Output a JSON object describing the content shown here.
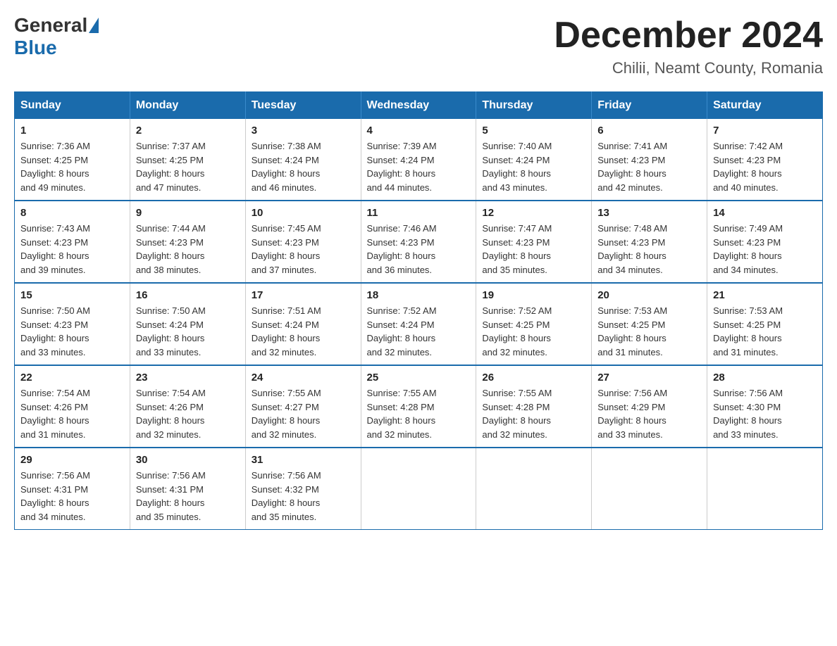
{
  "logo": {
    "general": "General",
    "blue": "Blue"
  },
  "title": "December 2024",
  "subtitle": "Chilii, Neamt County, Romania",
  "days_of_week": [
    "Sunday",
    "Monday",
    "Tuesday",
    "Wednesday",
    "Thursday",
    "Friday",
    "Saturday"
  ],
  "weeks": [
    [
      {
        "day": "1",
        "sunrise": "7:36 AM",
        "sunset": "4:25 PM",
        "daylight": "8 hours and 49 minutes."
      },
      {
        "day": "2",
        "sunrise": "7:37 AM",
        "sunset": "4:25 PM",
        "daylight": "8 hours and 47 minutes."
      },
      {
        "day": "3",
        "sunrise": "7:38 AM",
        "sunset": "4:24 PM",
        "daylight": "8 hours and 46 minutes."
      },
      {
        "day": "4",
        "sunrise": "7:39 AM",
        "sunset": "4:24 PM",
        "daylight": "8 hours and 44 minutes."
      },
      {
        "day": "5",
        "sunrise": "7:40 AM",
        "sunset": "4:24 PM",
        "daylight": "8 hours and 43 minutes."
      },
      {
        "day": "6",
        "sunrise": "7:41 AM",
        "sunset": "4:23 PM",
        "daylight": "8 hours and 42 minutes."
      },
      {
        "day": "7",
        "sunrise": "7:42 AM",
        "sunset": "4:23 PM",
        "daylight": "8 hours and 40 minutes."
      }
    ],
    [
      {
        "day": "8",
        "sunrise": "7:43 AM",
        "sunset": "4:23 PM",
        "daylight": "8 hours and 39 minutes."
      },
      {
        "day": "9",
        "sunrise": "7:44 AM",
        "sunset": "4:23 PM",
        "daylight": "8 hours and 38 minutes."
      },
      {
        "day": "10",
        "sunrise": "7:45 AM",
        "sunset": "4:23 PM",
        "daylight": "8 hours and 37 minutes."
      },
      {
        "day": "11",
        "sunrise": "7:46 AM",
        "sunset": "4:23 PM",
        "daylight": "8 hours and 36 minutes."
      },
      {
        "day": "12",
        "sunrise": "7:47 AM",
        "sunset": "4:23 PM",
        "daylight": "8 hours and 35 minutes."
      },
      {
        "day": "13",
        "sunrise": "7:48 AM",
        "sunset": "4:23 PM",
        "daylight": "8 hours and 34 minutes."
      },
      {
        "day": "14",
        "sunrise": "7:49 AM",
        "sunset": "4:23 PM",
        "daylight": "8 hours and 34 minutes."
      }
    ],
    [
      {
        "day": "15",
        "sunrise": "7:50 AM",
        "sunset": "4:23 PM",
        "daylight": "8 hours and 33 minutes."
      },
      {
        "day": "16",
        "sunrise": "7:50 AM",
        "sunset": "4:24 PM",
        "daylight": "8 hours and 33 minutes."
      },
      {
        "day": "17",
        "sunrise": "7:51 AM",
        "sunset": "4:24 PM",
        "daylight": "8 hours and 32 minutes."
      },
      {
        "day": "18",
        "sunrise": "7:52 AM",
        "sunset": "4:24 PM",
        "daylight": "8 hours and 32 minutes."
      },
      {
        "day": "19",
        "sunrise": "7:52 AM",
        "sunset": "4:25 PM",
        "daylight": "8 hours and 32 minutes."
      },
      {
        "day": "20",
        "sunrise": "7:53 AM",
        "sunset": "4:25 PM",
        "daylight": "8 hours and 31 minutes."
      },
      {
        "day": "21",
        "sunrise": "7:53 AM",
        "sunset": "4:25 PM",
        "daylight": "8 hours and 31 minutes."
      }
    ],
    [
      {
        "day": "22",
        "sunrise": "7:54 AM",
        "sunset": "4:26 PM",
        "daylight": "8 hours and 31 minutes."
      },
      {
        "day": "23",
        "sunrise": "7:54 AM",
        "sunset": "4:26 PM",
        "daylight": "8 hours and 32 minutes."
      },
      {
        "day": "24",
        "sunrise": "7:55 AM",
        "sunset": "4:27 PM",
        "daylight": "8 hours and 32 minutes."
      },
      {
        "day": "25",
        "sunrise": "7:55 AM",
        "sunset": "4:28 PM",
        "daylight": "8 hours and 32 minutes."
      },
      {
        "day": "26",
        "sunrise": "7:55 AM",
        "sunset": "4:28 PM",
        "daylight": "8 hours and 32 minutes."
      },
      {
        "day": "27",
        "sunrise": "7:56 AM",
        "sunset": "4:29 PM",
        "daylight": "8 hours and 33 minutes."
      },
      {
        "day": "28",
        "sunrise": "7:56 AM",
        "sunset": "4:30 PM",
        "daylight": "8 hours and 33 minutes."
      }
    ],
    [
      {
        "day": "29",
        "sunrise": "7:56 AM",
        "sunset": "4:31 PM",
        "daylight": "8 hours and 34 minutes."
      },
      {
        "day": "30",
        "sunrise": "7:56 AM",
        "sunset": "4:31 PM",
        "daylight": "8 hours and 35 minutes."
      },
      {
        "day": "31",
        "sunrise": "7:56 AM",
        "sunset": "4:32 PM",
        "daylight": "8 hours and 35 minutes."
      },
      null,
      null,
      null,
      null
    ]
  ],
  "labels": {
    "sunrise": "Sunrise:",
    "sunset": "Sunset:",
    "daylight": "Daylight:"
  }
}
